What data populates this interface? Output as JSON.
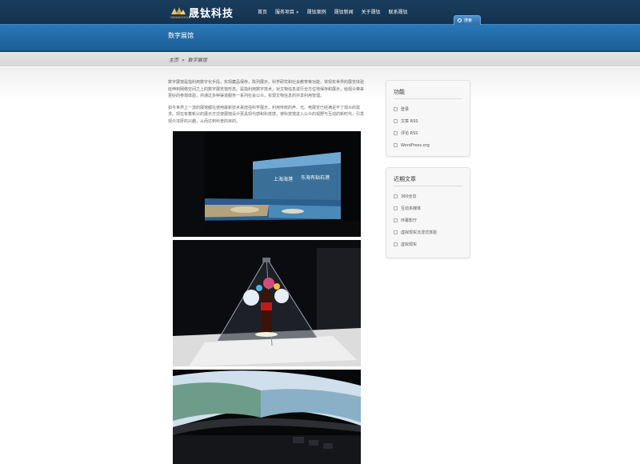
{
  "header": {
    "logo_text": "晟钛科技",
    "logo_sub": "SENWOOCO",
    "nav": [
      "首页",
      "服务项目 »",
      "晟钛案例",
      "晟钛新闻",
      "关于晟钛",
      "联系晟钛"
    ],
    "search_label": "搜索"
  },
  "banner": {
    "title": "数字展馆"
  },
  "breadcrumb": {
    "home": "主页",
    "separator": "»",
    "current": "数字展馆"
  },
  "article": {
    "paragraphs": [
      "数字展馆是指利用数字化手段，实现藏品保存，陈列展示，科学研究和社会教育等功能，将现实世界的展览体验延伸到网络空间之上的数字展览馆形态。是指利用数字技术，对文物信息进行全方位地保存和展示，给观众带来更好的参观体验，并通过多种渠道服务一系列社会公众，实现文物信息的共享利用管理。",
      "如今世界上一流的展馆都在使用最新技术来增强科学展示，利用传统的声、光、电展览已经满足不了观众的需求。现在有着新兴的展示方式使展馆设计更具现代感和科技感，使科技馆进入公众的视野与互动的新时代，引发观众浓厚的兴趣，从而达到科普的目的。"
    ]
  },
  "sidebar": {
    "functions": {
      "title": "功能",
      "items": [
        "登录",
        "文章 RSS",
        "评论 RSS",
        "WordPress.org"
      ]
    },
    "recent": {
      "title": "近期文章",
      "items": [
        "360全息",
        "互动多媒体",
        "环幕影厅",
        "虚拟现实沉浸式体验",
        "虚拟现实"
      ]
    }
  },
  "colors": {
    "header": "#14324f",
    "banner": "#2a78b8",
    "accent": "#e0c070"
  }
}
